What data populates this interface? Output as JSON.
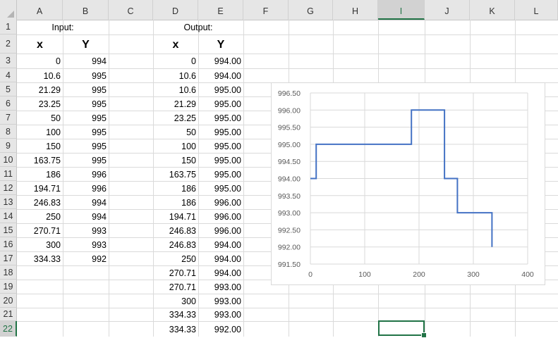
{
  "columns": [
    "A",
    "B",
    "C",
    "D",
    "E",
    "F",
    "G",
    "H",
    "I",
    "J",
    "K",
    "L"
  ],
  "selected_column": "I",
  "rows": [
    "1",
    "2",
    "3",
    "4",
    "5",
    "6",
    "7",
    "8",
    "9",
    "10",
    "11",
    "12",
    "13",
    "14",
    "15",
    "16",
    "17",
    "18",
    "19",
    "20",
    "21",
    "22"
  ],
  "selected_row": "22",
  "headers": {
    "input_label": "Input:",
    "output_label": "Output:",
    "x": "x",
    "y": "Y"
  },
  "input_table": [
    [
      "0",
      "994"
    ],
    [
      "10.6",
      "995"
    ],
    [
      "21.29",
      "995"
    ],
    [
      "23.25",
      "995"
    ],
    [
      "50",
      "995"
    ],
    [
      "100",
      "995"
    ],
    [
      "150",
      "995"
    ],
    [
      "163.75",
      "995"
    ],
    [
      "186",
      "996"
    ],
    [
      "194.71",
      "996"
    ],
    [
      "246.83",
      "994"
    ],
    [
      "250",
      "994"
    ],
    [
      "270.71",
      "993"
    ],
    [
      "300",
      "993"
    ],
    [
      "334.33",
      "992"
    ]
  ],
  "output_table": [
    [
      "0",
      "994.00"
    ],
    [
      "10.6",
      "994.00"
    ],
    [
      "10.6",
      "995.00"
    ],
    [
      "21.29",
      "995.00"
    ],
    [
      "23.25",
      "995.00"
    ],
    [
      "50",
      "995.00"
    ],
    [
      "100",
      "995.00"
    ],
    [
      "150",
      "995.00"
    ],
    [
      "163.75",
      "995.00"
    ],
    [
      "186",
      "995.00"
    ],
    [
      "186",
      "996.00"
    ],
    [
      "194.71",
      "996.00"
    ],
    [
      "246.83",
      "996.00"
    ],
    [
      "246.83",
      "994.00"
    ],
    [
      "250",
      "994.00"
    ],
    [
      "270.71",
      "994.00"
    ],
    [
      "270.71",
      "993.00"
    ],
    [
      "300",
      "993.00"
    ],
    [
      "334.33",
      "993.00"
    ],
    [
      "334.33",
      "992.00"
    ]
  ],
  "chart_data": {
    "type": "line",
    "x": [
      0,
      10.6,
      10.6,
      21.29,
      23.25,
      50,
      100,
      150,
      163.75,
      186,
      186,
      194.71,
      246.83,
      246.83,
      250,
      270.71,
      270.71,
      300,
      334.33,
      334.33
    ],
    "series": [
      {
        "values": [
          994,
          994,
          995,
          995,
          995,
          995,
          995,
          995,
          995,
          995,
          996,
          996,
          996,
          994,
          994,
          994,
          993,
          993,
          993,
          992
        ]
      }
    ],
    "xlim": [
      0,
      400
    ],
    "ylim": [
      991.5,
      996.5
    ],
    "x_ticks": [
      "0",
      "100",
      "200",
      "300",
      "400"
    ],
    "y_ticks": [
      "991.50",
      "992.00",
      "992.50",
      "993.00",
      "993.50",
      "994.00",
      "994.50",
      "995.00",
      "995.50",
      "996.00",
      "996.50"
    ],
    "line_color": "#4472c4",
    "grid": true
  }
}
